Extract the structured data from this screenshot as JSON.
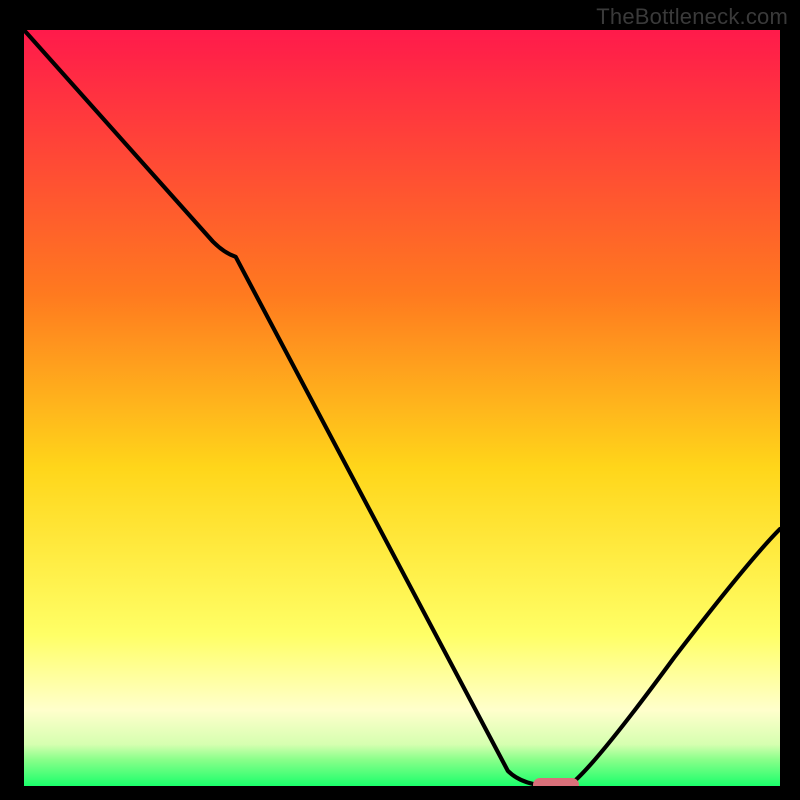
{
  "watermark": "TheBottleneck.com",
  "colors": {
    "top": "#ff1a4b",
    "upper_mid": "#ff7a1f",
    "mid": "#ffd61a",
    "lower_mid": "#ffff66",
    "pale": "#ffffcc",
    "green_light": "#8aff8a",
    "green": "#1bff6b",
    "curve": "#000000",
    "marker": "#d9707a",
    "axis": "#000000"
  },
  "chart_data": {
    "type": "line",
    "title": "",
    "xlabel": "",
    "ylabel": "",
    "xlim": [
      0,
      100
    ],
    "ylim": [
      0,
      100
    ],
    "x": [
      0,
      25,
      28,
      64,
      70,
      72,
      100
    ],
    "values": [
      100,
      72,
      70,
      2,
      0,
      0,
      34
    ],
    "marker": {
      "x_start": 67,
      "x_end": 73,
      "y": 0
    },
    "gradient_stops": [
      {
        "pos": 0.0,
        "color": "#ff1a4b"
      },
      {
        "pos": 0.35,
        "color": "#ff7a1f"
      },
      {
        "pos": 0.58,
        "color": "#ffd61a"
      },
      {
        "pos": 0.8,
        "color": "#ffff66"
      },
      {
        "pos": 0.9,
        "color": "#ffffcc"
      },
      {
        "pos": 0.945,
        "color": "#d6ffb0"
      },
      {
        "pos": 0.965,
        "color": "#8aff8a"
      },
      {
        "pos": 1.0,
        "color": "#1bff6b"
      }
    ]
  }
}
